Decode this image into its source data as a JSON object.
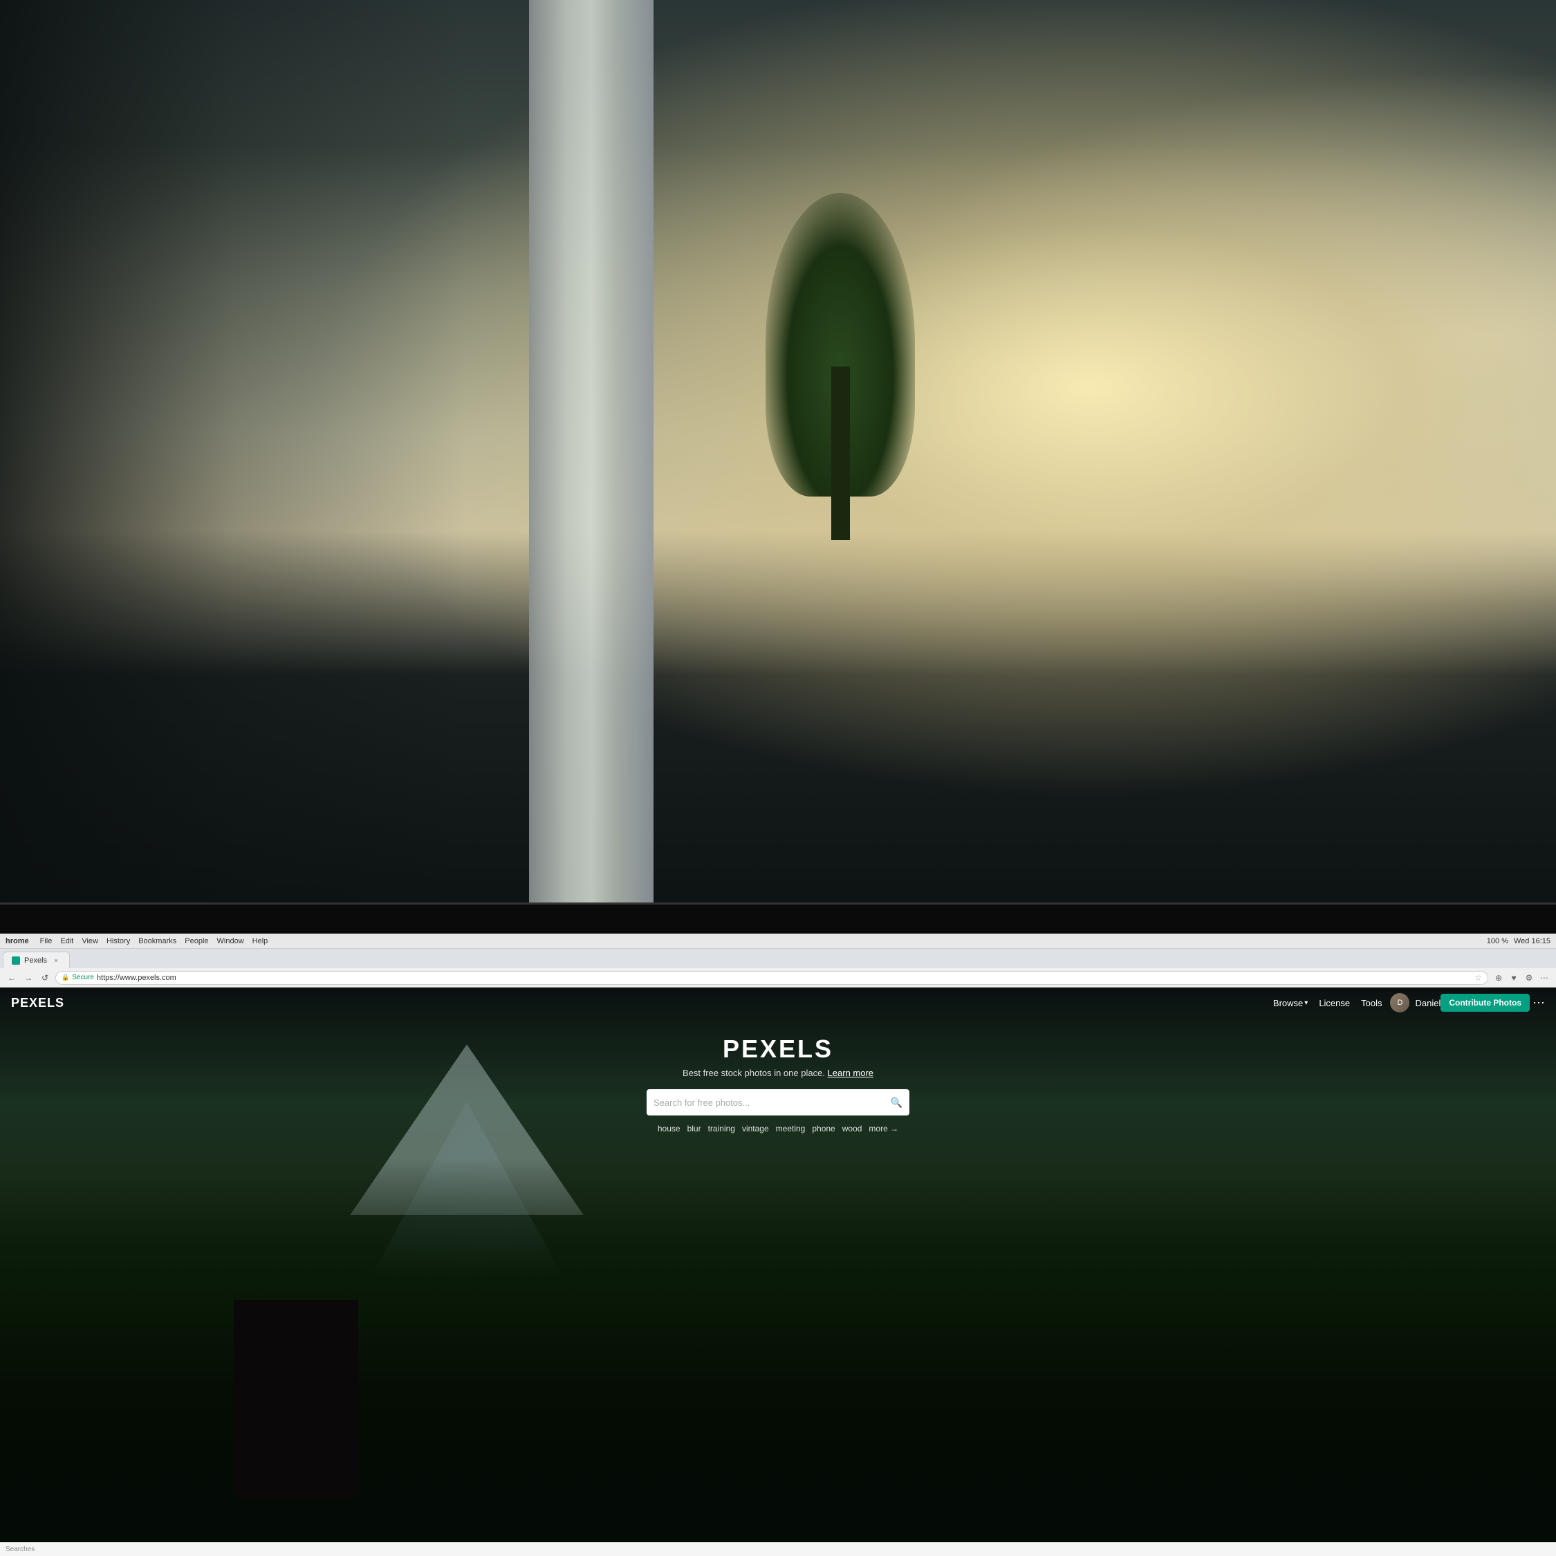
{
  "background": {
    "description": "Office interior background photo with blur"
  },
  "monitor": {
    "bezel_color": "#0a0a0a"
  },
  "browser": {
    "menu_bar": {
      "app_name": "hrome",
      "menu_items": [
        "File",
        "Edit",
        "View",
        "History",
        "Bookmarks",
        "People",
        "Window",
        "Help"
      ],
      "right_status": {
        "battery": "100 %",
        "time": "Wed 16:15"
      }
    },
    "tab": {
      "title": "Pexels",
      "favicon_color": "#05a081",
      "close_label": "×"
    },
    "address_bar": {
      "back_btn": "←",
      "forward_btn": "→",
      "refresh_btn": "↺",
      "secure_label": "Secure",
      "url": "https://www.pexels.com",
      "bookmark_icon": "☆",
      "nav_icons": [
        "▼",
        "♥",
        "⚙",
        "⋯"
      ]
    }
  },
  "pexels": {
    "nav": {
      "logo": "PEXELS",
      "links": [
        {
          "label": "Browse",
          "has_dropdown": true
        },
        {
          "label": "License"
        },
        {
          "label": "Tools"
        }
      ],
      "user": {
        "avatar_initials": "D",
        "name": "Daniel"
      },
      "contribute_btn": "Contribute Photos",
      "more_btn": "⋯"
    },
    "hero": {
      "title": "PEXELS",
      "tagline": "Best free stock photos in one place.",
      "learn_more": "Learn more",
      "search_placeholder": "Search for free photos...",
      "search_icon": "🔍",
      "suggestions": [
        {
          "label": "house"
        },
        {
          "label": "blur"
        },
        {
          "label": "training"
        },
        {
          "label": "vintage"
        },
        {
          "label": "meeting"
        },
        {
          "label": "phone"
        },
        {
          "label": "wood"
        },
        {
          "label": "more →"
        }
      ]
    }
  },
  "bottom_bar": {
    "text": "Searches"
  }
}
